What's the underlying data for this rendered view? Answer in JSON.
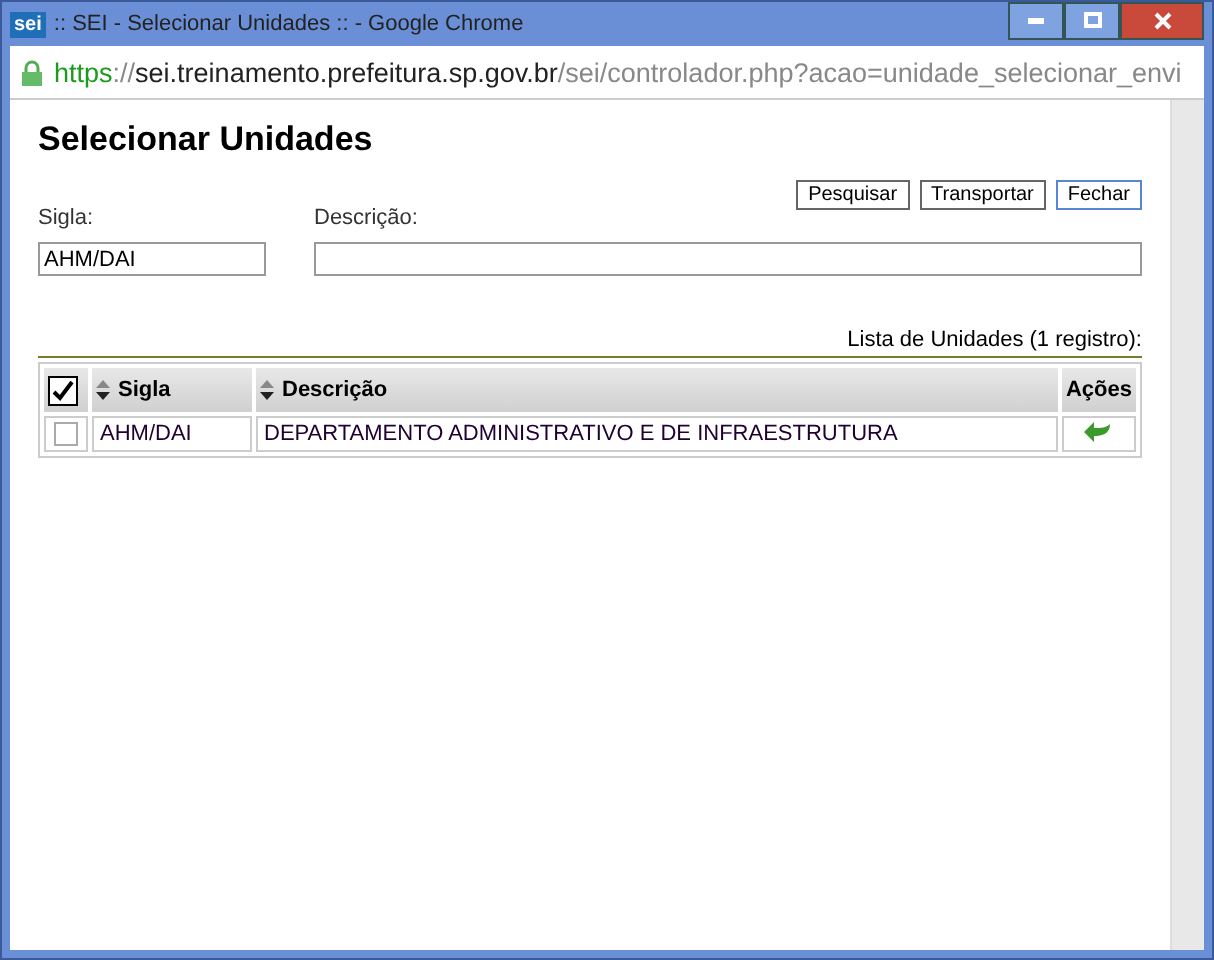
{
  "window": {
    "title": ":: SEI - Selecionar Unidades :: - Google Chrome",
    "app_badge": "sei"
  },
  "address_bar": {
    "scheme": "https",
    "separator": "://",
    "host": "sei.treinamento.prefeitura.sp.gov.br",
    "path": "/sei/controlador.php?acao=unidade_selecionar_envi"
  },
  "page": {
    "heading": "Selecionar Unidades",
    "buttons": [
      {
        "label": "Pesquisar",
        "focused": false
      },
      {
        "label": "Transportar",
        "focused": false
      },
      {
        "label": "Fechar",
        "focused": true
      }
    ],
    "filters": [
      {
        "label": "Sigla:",
        "value": "AHM/DAI"
      },
      {
        "label": "Descrição:"
      }
    ],
    "table": {
      "caption": "Lista de Unidades (1 registro):",
      "select_all_checked": true,
      "columns": [
        "Sigla",
        "Descrição",
        "Ações"
      ],
      "rows": [
        {
          "checked": false,
          "sigla": "AHM/DAI",
          "descricao": "DEPARTAMENTO ADMINISTRATIVO E DE INFRAESTRUTURA"
        }
      ]
    }
  }
}
